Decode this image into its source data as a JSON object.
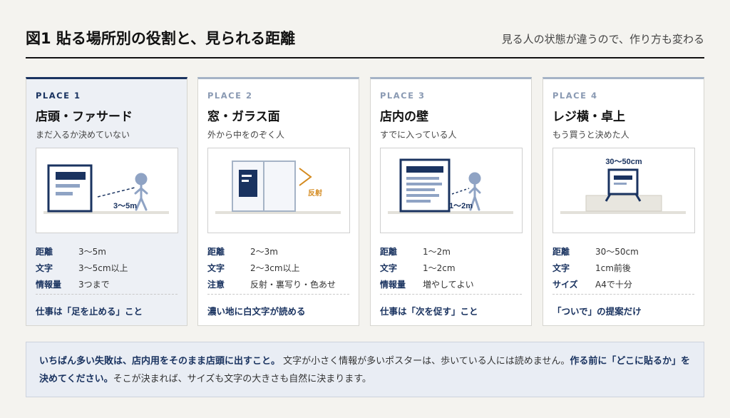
{
  "header": {
    "title": "図1  貼る場所別の役割と、見られる距離",
    "subtitle": "見る人の状態が違うので、作り方も変わる"
  },
  "cards": [
    {
      "place": "PLACE 1",
      "title": "店頭・ファサード",
      "desc": "まだ入るか決めていない",
      "illus_label": "3〜5m",
      "rows": [
        {
          "k": "距離",
          "v": "3〜5m"
        },
        {
          "k": "文字",
          "v": "3〜5cm以上"
        },
        {
          "k": "情報量",
          "v": "3つまで"
        }
      ],
      "foot": "仕事は「足を止める」こと",
      "active": true
    },
    {
      "place": "PLACE 2",
      "title": "窓・ガラス面",
      "desc": "外から中をのぞく人",
      "illus_label": "反射",
      "rows": [
        {
          "k": "距離",
          "v": "2〜3m"
        },
        {
          "k": "文字",
          "v": "2〜3cm以上"
        },
        {
          "k": "注意",
          "v": "反射・裏写り・色あせ"
        }
      ],
      "foot": "濃い地に白文字が読める"
    },
    {
      "place": "PLACE 3",
      "title": "店内の壁",
      "desc": "すでに入っている人",
      "illus_label": "1〜2m",
      "rows": [
        {
          "k": "距離",
          "v": "1〜2m"
        },
        {
          "k": "文字",
          "v": "1〜2cm"
        },
        {
          "k": "情報量",
          "v": "増やしてよい"
        }
      ],
      "foot": "仕事は「次を促す」こと"
    },
    {
      "place": "PLACE 4",
      "title": "レジ横・卓上",
      "desc": "もう買うと決めた人",
      "illus_label": "30〜50cm",
      "rows": [
        {
          "k": "距離",
          "v": "30〜50cm"
        },
        {
          "k": "文字",
          "v": "1cm前後"
        },
        {
          "k": "サイズ",
          "v": "A4で十分"
        }
      ],
      "foot": "「ついで」の提案だけ"
    }
  ],
  "note": {
    "bold1": "いちばん多い失敗は、店内用をそのまま店頭に出すこと。",
    "text1": "文字が小さく情報が多いポスターは、歩いている人には読めません。",
    "bold2": "作る前に「どこに貼るか」を決めてください。",
    "text2": "そこが決まれば、サイズも文字の大きさも自然に決まります。"
  },
  "colors": {
    "navy": "#1a3360",
    "light_blue": "#a5b3c6",
    "figure": "#8fa3c4",
    "accent_orange": "#d48a1e",
    "ground": "#e3e1da"
  }
}
